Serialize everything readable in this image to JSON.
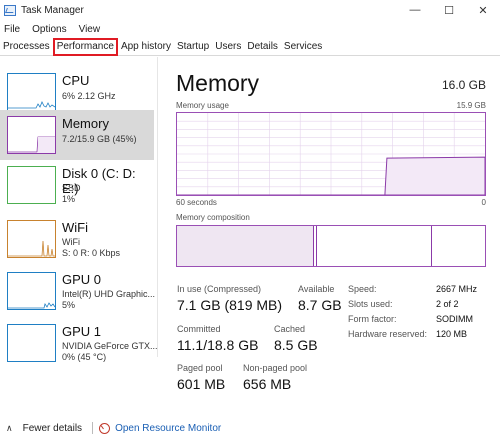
{
  "window": {
    "title": "Task Manager",
    "controls": {
      "minimize": "—",
      "maximize": "☐",
      "close": "✕"
    }
  },
  "menu": [
    "File",
    "Options",
    "View"
  ],
  "tabs": [
    {
      "label": "Processes",
      "active": false
    },
    {
      "label": "Performance",
      "active": true
    },
    {
      "label": "App history",
      "active": false
    },
    {
      "label": "Startup",
      "active": false
    },
    {
      "label": "Users",
      "active": false
    },
    {
      "label": "Details",
      "active": false
    },
    {
      "label": "Services",
      "active": false
    }
  ],
  "sidebar": {
    "items": [
      {
        "title": "CPU",
        "lines": [
          "6% 2.12 GHz"
        ],
        "color": "#1f7fc4",
        "selected": false
      },
      {
        "title": "Memory",
        "lines": [
          "7.2/15.9 GB (45%)"
        ],
        "color": "#8b3aa8",
        "selected": true
      },
      {
        "title": "Disk 0 (C: D: E:)",
        "lines": [
          "SSD",
          "1%"
        ],
        "color": "#4caf50",
        "selected": false
      },
      {
        "title": "WiFi",
        "lines": [
          "WiFi",
          "S: 0 R: 0 Kbps"
        ],
        "color": "#c8822e",
        "selected": false
      },
      {
        "title": "GPU 0",
        "lines": [
          "Intel(R) UHD Graphic...",
          "5%"
        ],
        "color": "#1f7fc4",
        "selected": false
      },
      {
        "title": "GPU 1",
        "lines": [
          "NVIDIA GeForce GTX...",
          "0% (45 °C)"
        ],
        "color": "#1f7fc4",
        "selected": false
      }
    ]
  },
  "main": {
    "title": "Memory",
    "total": "16.0 GB",
    "usage_label": "Memory usage",
    "usage_max": "15.9 GB",
    "axis_left": "60 seconds",
    "axis_right": "0",
    "composition_label": "Memory composition",
    "usage_fraction": 0.45,
    "stats": {
      "in_use_label": "In use (Compressed)",
      "in_use_value": "7.1 GB (819 MB)",
      "available_label": "Available",
      "available_value": "8.7 GB",
      "committed_label": "Committed",
      "committed_value": "11.1/18.8 GB",
      "cached_label": "Cached",
      "cached_value": "8.5 GB",
      "paged_label": "Paged pool",
      "paged_value": "601 MB",
      "nonpaged_label": "Non-paged pool",
      "nonpaged_value": "656 MB"
    },
    "details": [
      {
        "label": "Speed:",
        "value": "2667 MHz"
      },
      {
        "label": "Slots used:",
        "value": "2 of 2"
      },
      {
        "label": "Form factor:",
        "value": "SODIMM"
      },
      {
        "label": "Hardware reserved:",
        "value": "120 MB"
      }
    ]
  },
  "footer": {
    "fewer_details": "Fewer details",
    "resource_monitor": "Open Resource Monitor"
  },
  "colors": {
    "accent": "#8b3aa8",
    "highlight": "#e01b24",
    "link": "#1a5fb4"
  }
}
